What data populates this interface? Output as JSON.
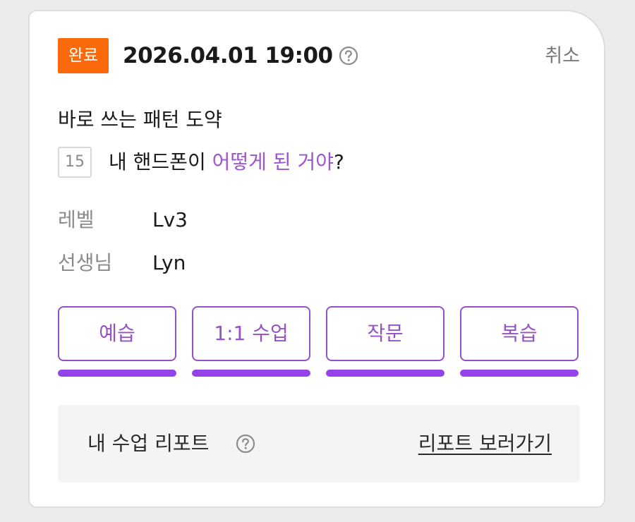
{
  "status_badge": "완료",
  "datetime": "2026.04.01 19:00",
  "cancel_label": "취소",
  "course_name": "바로 쓰는 패턴 도약",
  "lesson": {
    "number": "15",
    "title_prefix": "내 핸드폰이 ",
    "title_highlight": "어떻게 된 거야",
    "title_suffix": "?"
  },
  "info": [
    {
      "label": "레벨",
      "value": "Lv3"
    },
    {
      "label": "선생님",
      "value": "Lyn"
    }
  ],
  "buttons": [
    "예습",
    "1:1 수업",
    "작문",
    "복습"
  ],
  "report": {
    "label": "내 수업 리포트",
    "link_label": "리포트 보러가기"
  },
  "colors": {
    "badge": "#fa6a0a",
    "accent": "#9552c8",
    "progress": "#9343e8",
    "highlight_text": "#9a55cf"
  },
  "icons": {
    "help": "help-circle-icon"
  }
}
